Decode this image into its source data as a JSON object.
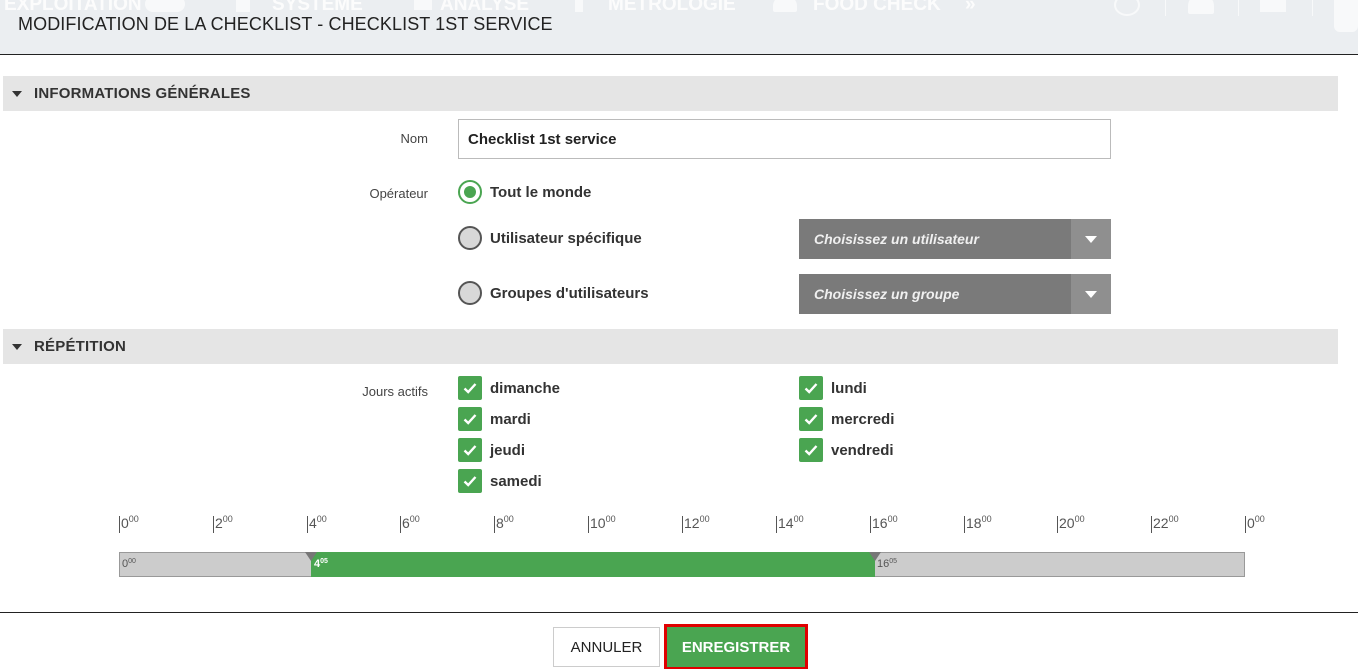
{
  "header": {
    "title": "MODIFICATION DE LA CHECKLIST - CHECKLIST 1ST SERVICE",
    "nav_items": [
      "EXPLOITATION",
      "SYSTÈME",
      "ANALYSE",
      "MÉTROLOGIE",
      "FOOD CHECK"
    ],
    "nav_more": "»"
  },
  "sections": {
    "general": "INFORMATIONS GÉNÉRALES",
    "repetition": "RÉPÉTITION"
  },
  "form": {
    "name_label": "Nom",
    "name_value": "Checklist 1st service",
    "operator_label": "Opérateur",
    "operator_options": [
      {
        "label": "Tout le monde",
        "selected": true
      },
      {
        "label": "Utilisateur spécifique",
        "selected": false
      },
      {
        "label": "Groupes d'utilisateurs",
        "selected": false
      }
    ],
    "user_select_placeholder": "Choisissez un utilisateur",
    "group_select_placeholder": "Choisissez un groupe",
    "active_days_label": "Jours actifs",
    "days": [
      {
        "label": "dimanche",
        "checked": true
      },
      {
        "label": "lundi",
        "checked": true
      },
      {
        "label": "mardi",
        "checked": true
      },
      {
        "label": "mercredi",
        "checked": true
      },
      {
        "label": "jeudi",
        "checked": true
      },
      {
        "label": "vendredi",
        "checked": true
      },
      {
        "label": "samedi",
        "checked": true
      }
    ]
  },
  "time_range": {
    "scale_hours": [
      "0",
      "2",
      "4",
      "6",
      "8",
      "10",
      "12",
      "14",
      "16",
      "18",
      "20",
      "22",
      "0"
    ],
    "scale_minutes": "00",
    "track_start": {
      "hour": "0",
      "minutes": "00"
    },
    "range_start": {
      "hour": "4",
      "minutes": "05"
    },
    "range_end": {
      "hour": "16",
      "minutes": "05"
    },
    "range_color": "#4aa551"
  },
  "footer": {
    "cancel_label": "ANNULER",
    "save_label": "ENREGISTRER"
  },
  "colors": {
    "accent": "#4aa551",
    "highlight": "#e00000"
  }
}
